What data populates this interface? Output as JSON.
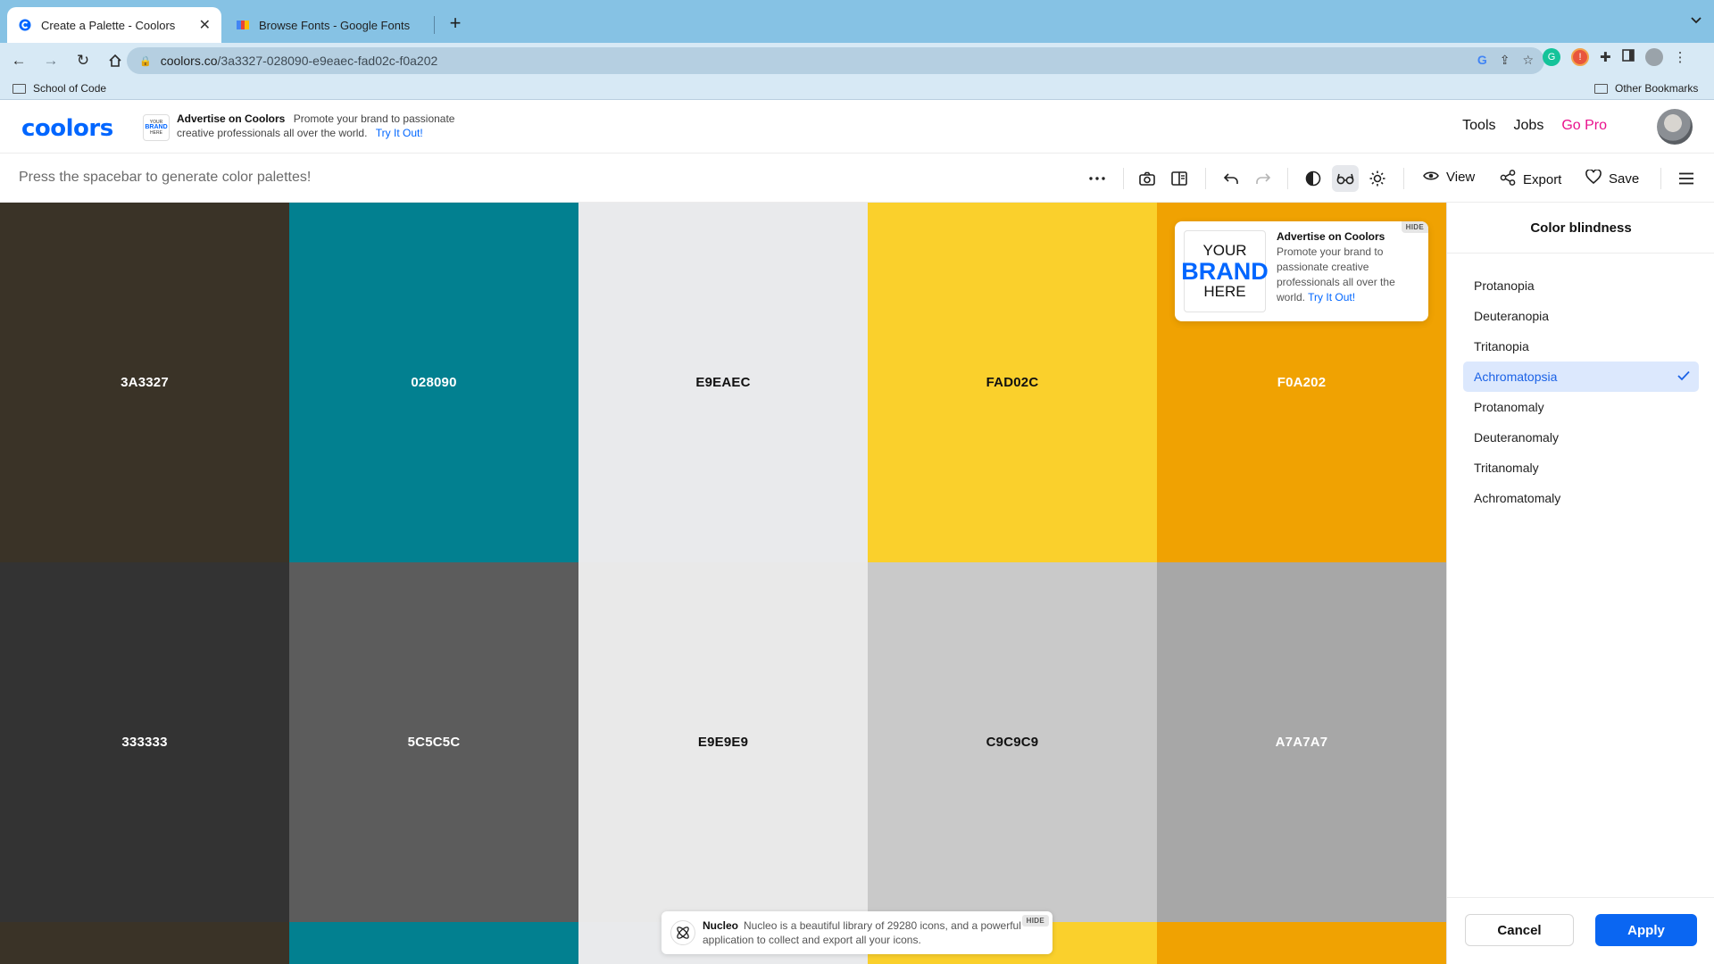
{
  "browser": {
    "tabs": [
      {
        "title": "Create a Palette - Coolors",
        "active": true
      },
      {
        "title": "Browse Fonts - Google Fonts",
        "active": false
      }
    ],
    "url_host": "coolors.co",
    "url_path": "/3a3327-028090-e9eaec-fad02c-f0a202",
    "bookmarks": {
      "left": "School of Code",
      "right": "Other Bookmarks"
    }
  },
  "header": {
    "logo": "coolors",
    "ad": {
      "title": "Advertise on Coolors",
      "body": "Promote your brand to passionate creative professionals all over the world.",
      "link": "Try It Out!"
    },
    "nav": {
      "tools": "Tools",
      "jobs": "Jobs",
      "pro": "Go Pro"
    }
  },
  "generator_bar": {
    "hint": "Press the spacebar to generate color palettes!",
    "view_label": "View",
    "export_label": "Export",
    "save_label": "Save"
  },
  "palette": {
    "original": [
      {
        "hex": "3A3327",
        "color": "#3A3327",
        "text": "#ffffff"
      },
      {
        "hex": "028090",
        "color": "#028090",
        "text": "#ffffff"
      },
      {
        "hex": "E9EAEC",
        "color": "#E9EAEC",
        "text": "#111111"
      },
      {
        "hex": "FAD02C",
        "color": "#FAD02C",
        "text": "#111111"
      },
      {
        "hex": "F0A202",
        "color": "#F0A202",
        "text": "#ffffff"
      }
    ],
    "simulated": [
      {
        "hex": "333333",
        "color": "#333333",
        "text": "#ffffff"
      },
      {
        "hex": "5C5C5C",
        "color": "#5C5C5C",
        "text": "#ffffff"
      },
      {
        "hex": "E9E9E9",
        "color": "#E9E9E9",
        "text": "#111111"
      },
      {
        "hex": "C9C9C9",
        "color": "#C9C9C9",
        "text": "#111111"
      },
      {
        "hex": "A7A7A7",
        "color": "#A7A7A7",
        "text": "#ffffff"
      }
    ]
  },
  "ad_card": {
    "logo_lines": [
      "YOUR",
      "BRAND",
      "HERE"
    ],
    "title": "Advertise on Coolors",
    "body": "Promote your brand to passionate creative professionals all over the world.",
    "link": "Try It Out!",
    "hide": "HIDE"
  },
  "nucleo_ad": {
    "title": "Nucleo",
    "body": "Nucleo is a beautiful library of 29280 icons, and a powerful application to collect and export all your icons.",
    "hide": "HIDE"
  },
  "panel": {
    "title": "Color blindness",
    "options": [
      "Protanopia",
      "Deuteranopia",
      "Tritanopia",
      "Achromatopsia",
      "Protanomaly",
      "Deuteranomaly",
      "Tritanomaly",
      "Achromatomaly"
    ],
    "selected": "Achromatopsia",
    "cancel": "Cancel",
    "apply": "Apply"
  },
  "colors": {
    "accent": "#0a66f2",
    "pro": "#e9118d",
    "selected_bg": "#dce8fd"
  }
}
